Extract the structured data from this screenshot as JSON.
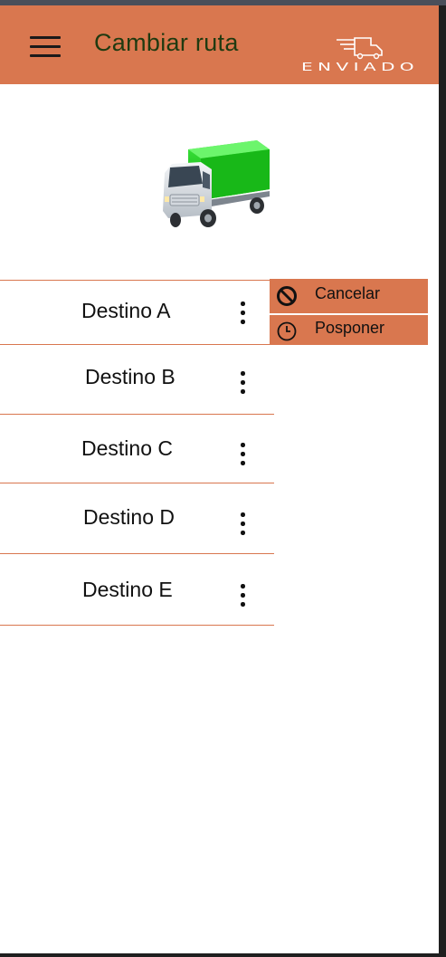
{
  "header": {
    "title": "Cambiar ruta",
    "logo_text": "ENVIADO",
    "background_color": "#d9774f"
  },
  "destinations": [
    {
      "label": "Destino A"
    },
    {
      "label": "Destino B"
    },
    {
      "label": "Destino C"
    },
    {
      "label": "Destino D"
    },
    {
      "label": "Destino E"
    }
  ],
  "context_menu": {
    "items": [
      {
        "label": "Cancelar",
        "icon": "cancel-icon"
      },
      {
        "label": "Posponer",
        "icon": "clock-icon"
      }
    ]
  },
  "icons": {
    "menu": "hamburger-menu-icon",
    "hero": "truck-icon",
    "row_action": "kebab-menu-icon"
  }
}
